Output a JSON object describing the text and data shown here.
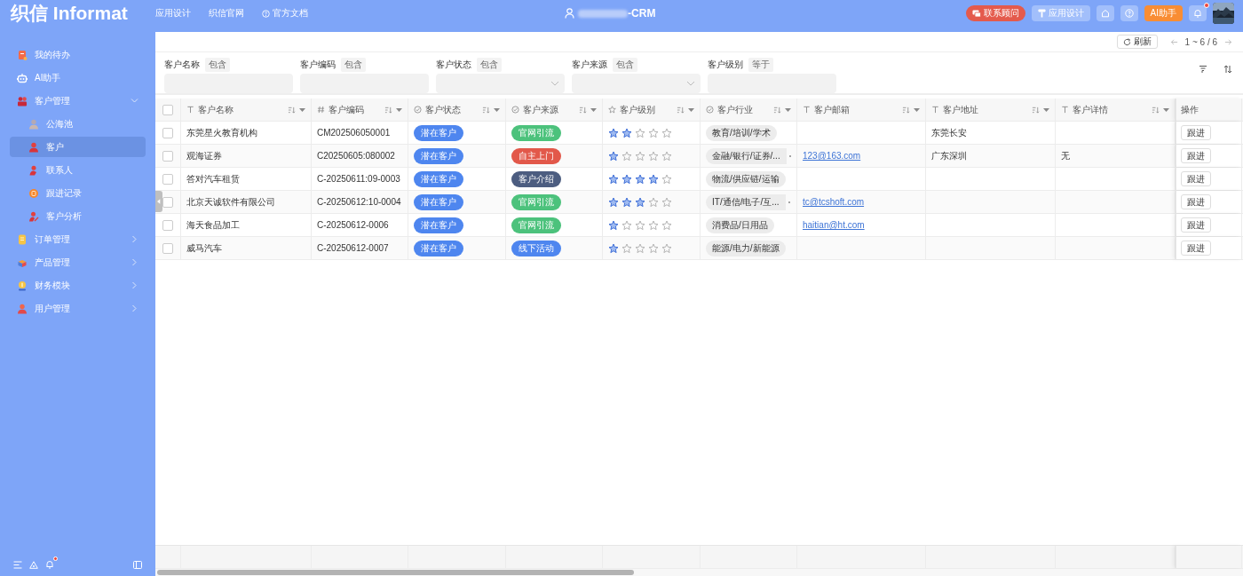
{
  "header": {
    "logo": "织信 Informat",
    "nav": [
      {
        "label": "应用设计",
        "kind": "link"
      },
      {
        "label": "织信官网",
        "kind": "link"
      },
      {
        "label": "官方文档",
        "kind": "help"
      }
    ],
    "title": "-CRM",
    "actions": [
      {
        "kind": "contact",
        "label": "联系顾问"
      },
      {
        "kind": "design",
        "label": "应用设计"
      },
      {
        "kind": "home"
      },
      {
        "kind": "help"
      },
      {
        "kind": "ai",
        "label": "AI助手"
      },
      {
        "kind": "bell",
        "unread": true
      },
      {
        "kind": "avatar"
      }
    ]
  },
  "sidebar": {
    "items": [
      {
        "label": "我的待办",
        "kind": "item",
        "selected": false
      },
      {
        "label": "AI助手",
        "kind": "item",
        "selected": false
      },
      {
        "label": "客户管理",
        "kind": "group",
        "expanded": true,
        "selected": false,
        "children": [
          {
            "label": "公海池",
            "selected": false
          },
          {
            "label": "客户",
            "selected": true
          },
          {
            "label": "联系人",
            "selected": false
          },
          {
            "label": "跟进记录",
            "selected": false
          },
          {
            "label": "客户分析",
            "selected": false
          }
        ]
      },
      {
        "label": "订单管理",
        "kind": "group",
        "expanded": false,
        "selected": false
      },
      {
        "label": "产品管理",
        "kind": "group",
        "expanded": false,
        "selected": false
      },
      {
        "label": "财务模块",
        "kind": "group",
        "expanded": false,
        "selected": false
      },
      {
        "label": "用户管理",
        "kind": "group",
        "expanded": false,
        "selected": false
      }
    ],
    "footer": {
      "bell_unread": true
    }
  },
  "toolbar": {
    "refresh": "刷新",
    "pagination": "1 ~ 6 / 6"
  },
  "filters": [
    {
      "label": "客户名称",
      "operator": "包含",
      "kind": "text"
    },
    {
      "label": "客户编码",
      "operator": "包含",
      "kind": "text"
    },
    {
      "label": "客户状态",
      "operator": "包含",
      "kind": "select"
    },
    {
      "label": "客户来源",
      "operator": "包含",
      "kind": "select"
    },
    {
      "label": "客户级别",
      "operator": "等于",
      "kind": "text"
    }
  ],
  "table": {
    "all_checked": false,
    "columns": [
      {
        "label": "客户名称"
      },
      {
        "label": "客户编码"
      },
      {
        "label": "客户状态"
      },
      {
        "label": "客户来源"
      },
      {
        "label": "客户级别"
      },
      {
        "label": "客户行业"
      },
      {
        "label": "客户邮箱"
      },
      {
        "label": "客户地址"
      },
      {
        "label": "客户详情"
      }
    ],
    "action_column": "操作",
    "rows": [
      {
        "checked": false,
        "name": "东莞星火教育机构",
        "code": "CM202506050001",
        "status": {
          "label": "潜在客户",
          "color": "#4e86ef"
        },
        "source": {
          "label": "官网引流",
          "color": "#4cc27c"
        },
        "stars": 2,
        "industry": "教育/培训/学术",
        "industry_more": false,
        "email": "",
        "address": "东莞长安",
        "details": "",
        "action": "跟进"
      },
      {
        "checked": false,
        "name": "观海证券",
        "code": "C20250605:080002",
        "status": {
          "label": "潜在客户",
          "color": "#4e86ef"
        },
        "source": {
          "label": "自主上门",
          "color": "#e2584a"
        },
        "stars": 1,
        "industry": "金融/银行/证券/...",
        "industry_more": true,
        "email": "123@163.com",
        "address": "广东深圳",
        "details": "无",
        "action": "跟进"
      },
      {
        "checked": false,
        "name": "答对汽车租赁",
        "code": "C-20250611:09-0003",
        "status": {
          "label": "潜在客户",
          "color": "#4e86ef"
        },
        "source": {
          "label": "客户介绍",
          "color": "#4c5d80"
        },
        "stars": 4,
        "industry": "物流/供应链/运输",
        "industry_more": false,
        "email": "",
        "address": "",
        "details": "",
        "action": "跟进"
      },
      {
        "checked": false,
        "name": "北京天诚软件有限公司",
        "code": "C-20250612:10-0004",
        "status": {
          "label": "潜在客户",
          "color": "#4e86ef"
        },
        "source": {
          "label": "官网引流",
          "color": "#4cc27c"
        },
        "stars": 3,
        "industry": "IT/通信/电子/互...",
        "industry_more": true,
        "email": "tc@tcshoft.com",
        "address": "",
        "details": "",
        "action": "跟进"
      },
      {
        "checked": false,
        "name": "海天食品加工",
        "code": "C-20250612-0006",
        "status": {
          "label": "潜在客户",
          "color": "#4e86ef"
        },
        "source": {
          "label": "官网引流",
          "color": "#4cc27c"
        },
        "stars": 1,
        "industry": "消费品/日用品",
        "industry_more": false,
        "email": "haitian@ht.com",
        "address": "",
        "details": "",
        "action": "跟进"
      },
      {
        "checked": false,
        "name": "威马汽车",
        "code": "C-20250612-0007",
        "status": {
          "label": "潜在客户",
          "color": "#4e86ef"
        },
        "source": {
          "label": "线下活动",
          "color": "#4e86ef"
        },
        "stars": 1,
        "industry": "能源/电力/新能源",
        "industry_more": false,
        "email": "",
        "address": "",
        "details": "",
        "action": "跟进"
      }
    ]
  }
}
